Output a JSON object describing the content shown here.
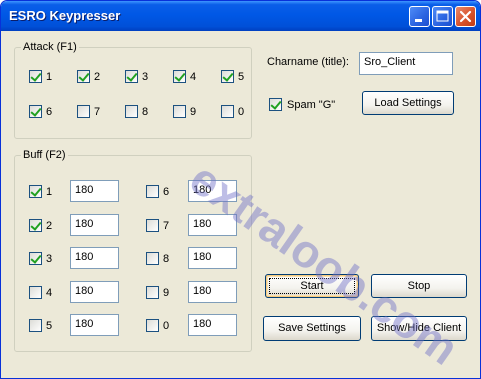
{
  "window": {
    "title": "ESRO Keypresser"
  },
  "attack": {
    "label": "Attack (F1)",
    "items": [
      {
        "label": "1",
        "checked": true
      },
      {
        "label": "2",
        "checked": true
      },
      {
        "label": "3",
        "checked": true
      },
      {
        "label": "4",
        "checked": true
      },
      {
        "label": "5",
        "checked": true
      },
      {
        "label": "6",
        "checked": true
      },
      {
        "label": "7",
        "checked": false
      },
      {
        "label": "8",
        "checked": false
      },
      {
        "label": "9",
        "checked": false
      },
      {
        "label": "0",
        "checked": false
      }
    ]
  },
  "buff": {
    "label": "Buff (F2)",
    "items": [
      {
        "label": "1",
        "checked": true,
        "value": "180"
      },
      {
        "label": "2",
        "checked": true,
        "value": "180"
      },
      {
        "label": "3",
        "checked": true,
        "value": "180"
      },
      {
        "label": "4",
        "checked": false,
        "value": "180"
      },
      {
        "label": "5",
        "checked": false,
        "value": "180"
      },
      {
        "label": "6",
        "checked": false,
        "value": "180"
      },
      {
        "label": "7",
        "checked": false,
        "value": "180"
      },
      {
        "label": "8",
        "checked": false,
        "value": "180"
      },
      {
        "label": "9",
        "checked": false,
        "value": "180"
      },
      {
        "label": "0",
        "checked": false,
        "value": "180"
      }
    ]
  },
  "charname": {
    "label": "Charname (title):",
    "value": "Sro_Client"
  },
  "spam": {
    "label": "Spam \"G\"",
    "checked": true
  },
  "buttons": {
    "load_settings": "Load Settings",
    "start": "Start",
    "stop": "Stop",
    "save_settings": "Save Settings",
    "show_hide_client": "Show/Hide Client"
  },
  "watermark": "extraloob.com",
  "icons": {
    "minimize": "minimize-icon",
    "maximize": "maximize-icon",
    "close": "close-icon"
  }
}
